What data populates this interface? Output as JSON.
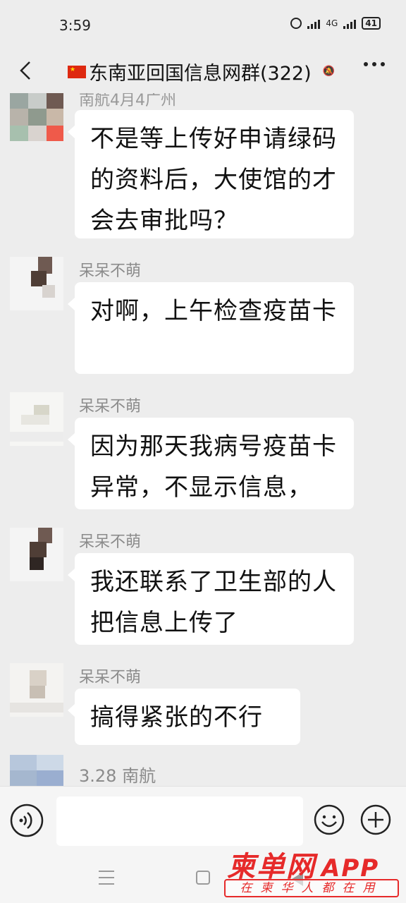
{
  "status_bar": {
    "time": "3:59",
    "network": "4G",
    "battery": "41"
  },
  "header": {
    "title": "东南亚回国信息网群(322)"
  },
  "messages": [
    {
      "sender": "",
      "sender_partial": "南航4月4广州",
      "text": "不是等上传好申请绿码的资料后，大使馆的才会去审批吗？"
    },
    {
      "sender": "呆呆不萌",
      "text": "对啊，上午检查疫苗卡"
    },
    {
      "sender": "呆呆不萌",
      "text": "因为那天我病号疫苗卡异常，不显示信息，"
    },
    {
      "sender": "呆呆不萌",
      "text": "我还联系了卫生部的人把信息上传了"
    },
    {
      "sender": "呆呆不萌",
      "text": "搞得紧张的不行"
    },
    {
      "sender": "3.28 南航",
      "text": ""
    }
  ],
  "input_bar": {
    "placeholder": ""
  },
  "watermark": {
    "logo": "柬单网",
    "app": "APP",
    "slogan": "在柬华人都在用"
  }
}
